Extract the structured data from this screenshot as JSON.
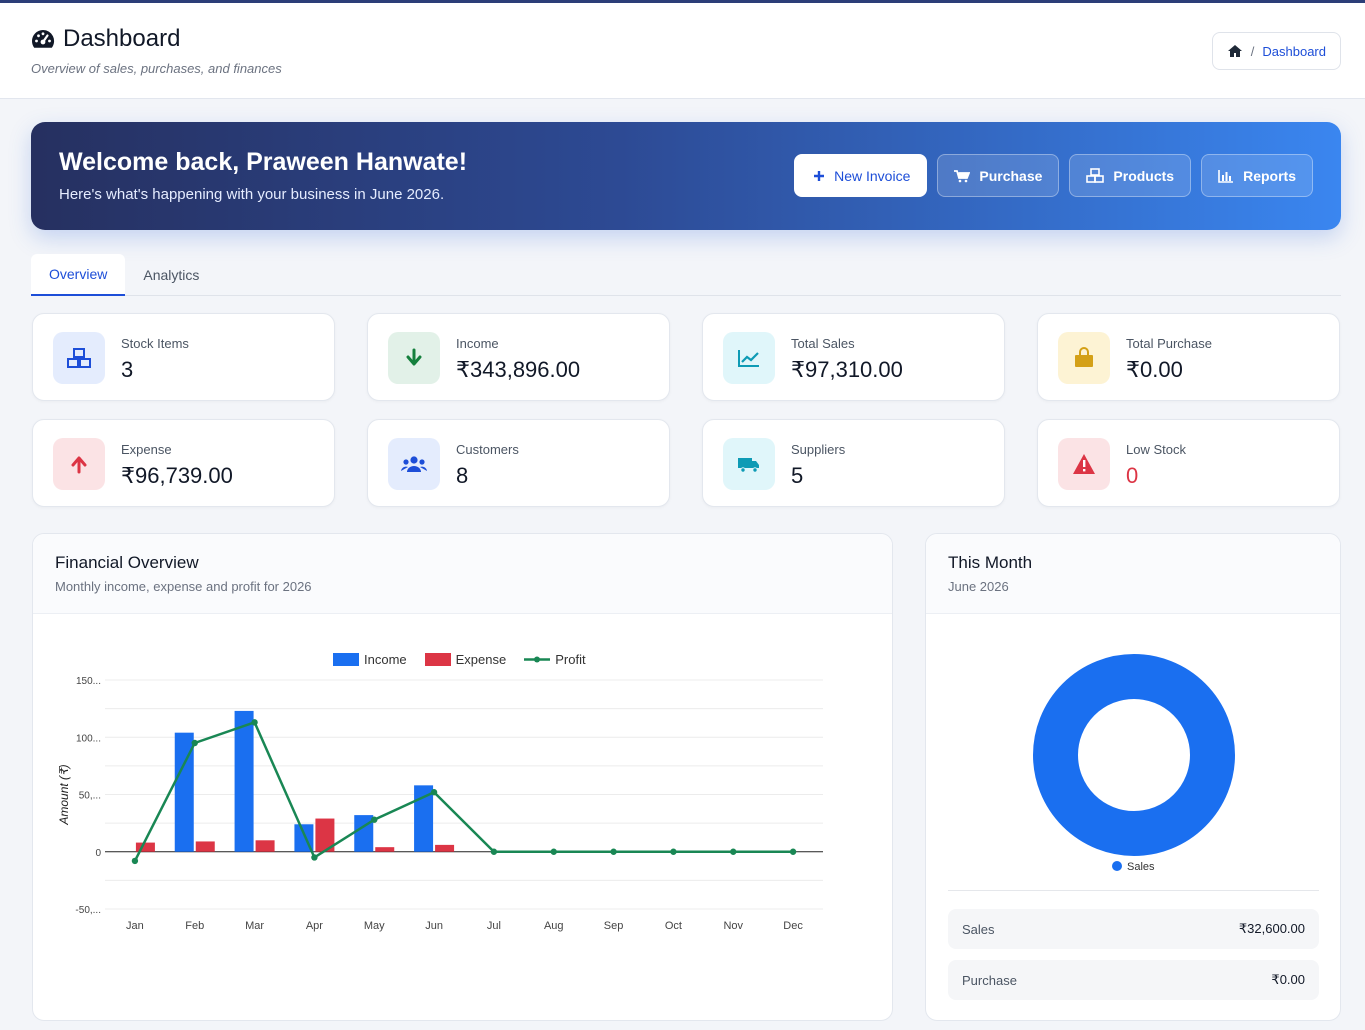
{
  "header": {
    "title": "Dashboard",
    "subtitle": "Overview of sales, purchases, and finances",
    "breadcrumb_current": "Dashboard"
  },
  "hero": {
    "greeting": "Welcome back, Praween Hanwate!",
    "message": "Here's what's happening with your business in June 2026.",
    "actions": [
      {
        "label": "New Invoice",
        "icon": "plus-icon"
      },
      {
        "label": "Purchase",
        "icon": "cart-icon"
      },
      {
        "label": "Products",
        "icon": "cubes-icon"
      },
      {
        "label": "Reports",
        "icon": "bar-chart-icon"
      }
    ]
  },
  "tabs": [
    {
      "label": "Overview",
      "active": true
    },
    {
      "label": "Analytics",
      "active": false
    }
  ],
  "stats": [
    {
      "label": "Stock Items",
      "value": "3",
      "icon": "cubes-icon",
      "accent": "#1d4ed8"
    },
    {
      "label": "Income",
      "value": "₹343,896.00",
      "icon": "arrow-down-icon",
      "accent": "#15803d"
    },
    {
      "label": "Total Sales",
      "value": "₹97,310.00",
      "icon": "line-chart-icon",
      "accent": "#0e9bb5"
    },
    {
      "label": "Total Purchase",
      "value": "₹0.00",
      "icon": "shopping-bag-icon",
      "accent": "#d4a017"
    },
    {
      "label": "Expense",
      "value": "₹96,739.00",
      "icon": "arrow-up-icon",
      "accent": "#dc3545"
    },
    {
      "label": "Customers",
      "value": "8",
      "icon": "users-icon",
      "accent": "#1d4ed8"
    },
    {
      "label": "Suppliers",
      "value": "5",
      "icon": "truck-icon",
      "accent": "#0e9bb5"
    },
    {
      "label": "Low Stock",
      "value": "0",
      "icon": "warning-icon",
      "accent": "#dc3545"
    }
  ],
  "financial": {
    "title": "Financial Overview",
    "subtitle": "Monthly income, expense and profit for 2026"
  },
  "this_month": {
    "title": "This Month",
    "subtitle": "June 2026",
    "legend": "Sales",
    "rows": [
      {
        "label": "Sales",
        "value": "₹32,600.00"
      },
      {
        "label": "Purchase",
        "value": "₹0.00"
      }
    ]
  },
  "chart_data": [
    {
      "type": "bar",
      "categories": [
        "Jan",
        "Feb",
        "Mar",
        "Apr",
        "May",
        "Jun",
        "Jul",
        "Aug",
        "Sep",
        "Oct",
        "Nov",
        "Dec"
      ],
      "series": [
        {
          "name": "Income",
          "type": "bar",
          "color": "#1a6ff0",
          "values": [
            0,
            104,
            123,
            24,
            32,
            58,
            0,
            0,
            0,
            0,
            0,
            0
          ]
        },
        {
          "name": "Expense",
          "type": "bar",
          "color": "#dc3545",
          "values": [
            8,
            9,
            10,
            29,
            4,
            6,
            0,
            0,
            0,
            0,
            0,
            0
          ]
        },
        {
          "name": "Profit",
          "type": "line",
          "color": "#198754",
          "values": [
            -8,
            95,
            113,
            -5,
            28,
            52,
            0,
            0,
            0,
            0,
            0,
            0
          ]
        }
      ],
      "ylabel": "Amount (₹)",
      "ylim": [
        -50,
        150
      ],
      "ytick_labels": [
        "150...",
        "100...",
        "50,...",
        "0",
        "-50,..."
      ],
      "grid": true,
      "legend_position": "top"
    },
    {
      "type": "pie",
      "categories": [
        "Sales"
      ],
      "values": [
        32600
      ],
      "colors": [
        "#1a6ff0"
      ],
      "legend_position": "bottom"
    }
  ]
}
